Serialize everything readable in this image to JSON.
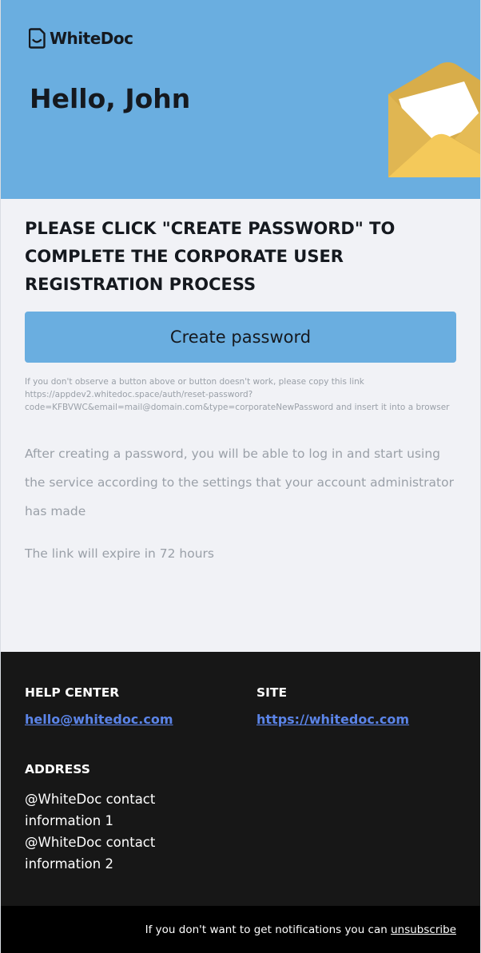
{
  "brand": {
    "name": "WhiteDoc",
    "logo_icon": "document-icon",
    "accent": "#6aaee0",
    "link_color": "#5b84e8"
  },
  "header": {
    "greeting": "Hello, John",
    "illustration": "envelope-icon"
  },
  "content": {
    "instruction": "PLEASE CLICK \"CREATE PASSWORD\" TO COMPLETE THE CORPORATE USER REGISTRATION PROCESS",
    "button_label": "Create password",
    "fallback_prefix": "If you don't observe a button above or button doesn't work, please copy this link ",
    "fallback_link": "https://appdev2.whitedoc.space/auth/reset-password?code=KFBVWC&email=mail@domain.com&type=corporateNewPassword",
    "fallback_suffix": " and insert it into a browser",
    "note": "After creating a password, you will be able to log in and start using the service according to the settings that your account administrator has made",
    "expire": "The link will expire in 72 hours"
  },
  "footer": {
    "help_center": {
      "heading": "HELP CENTER",
      "email": "hello@whitedoc.com"
    },
    "site": {
      "heading": "SITE",
      "url": "https://whitedoc.com"
    },
    "address": {
      "heading": "ADDRESS",
      "line1": "@WhiteDoc contact information 1",
      "line2": "@WhiteDoc contact information 2"
    }
  },
  "bottom": {
    "text": "If you don't want to get notifications you can ",
    "unsubscribe_label": "unsubscribe"
  }
}
